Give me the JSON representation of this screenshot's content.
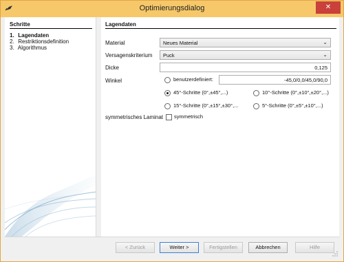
{
  "window": {
    "title": "Optimierungsdialog",
    "close_label": "✕"
  },
  "steps": {
    "title": "Schritte",
    "items": [
      {
        "num": "1.",
        "label": "Lagendaten",
        "active": true
      },
      {
        "num": "2.",
        "label": "Restriktionsdefinition",
        "active": false
      },
      {
        "num": "3.",
        "label": "Algorithmus",
        "active": false
      }
    ]
  },
  "content": {
    "title": "Lagendaten",
    "material": {
      "label": "Material",
      "value": "Neues Material"
    },
    "criterion": {
      "label": "Versagenskriterium",
      "value": "Puck"
    },
    "thickness": {
      "label": "Dicke",
      "value": "0,125"
    },
    "angle": {
      "label": "Winkel",
      "custom_label": "benutzerdefiniert:",
      "custom_value": "-45,0/0,0/45,0/90,0",
      "options": [
        {
          "label": "45°-Schritte (0°,±45°,...)",
          "selected": true
        },
        {
          "label": "10°-Schritte (0°,±10°,±20°,...)",
          "selected": false
        },
        {
          "label": "15°-Schritte (0°,±15°,±30°,...",
          "selected": false
        },
        {
          "label": "5°-Schritte (0°,±5°,±10°,...)",
          "selected": false
        }
      ]
    },
    "symmetric": {
      "label": "symmetrisches Laminat",
      "checkbox_label": "symmetrisch",
      "checked": false
    }
  },
  "buttons": {
    "back": "< Zurück",
    "next": "Weiter >",
    "finish": "Fertigstellen",
    "cancel": "Abbrechen",
    "help": "Hilfe"
  }
}
